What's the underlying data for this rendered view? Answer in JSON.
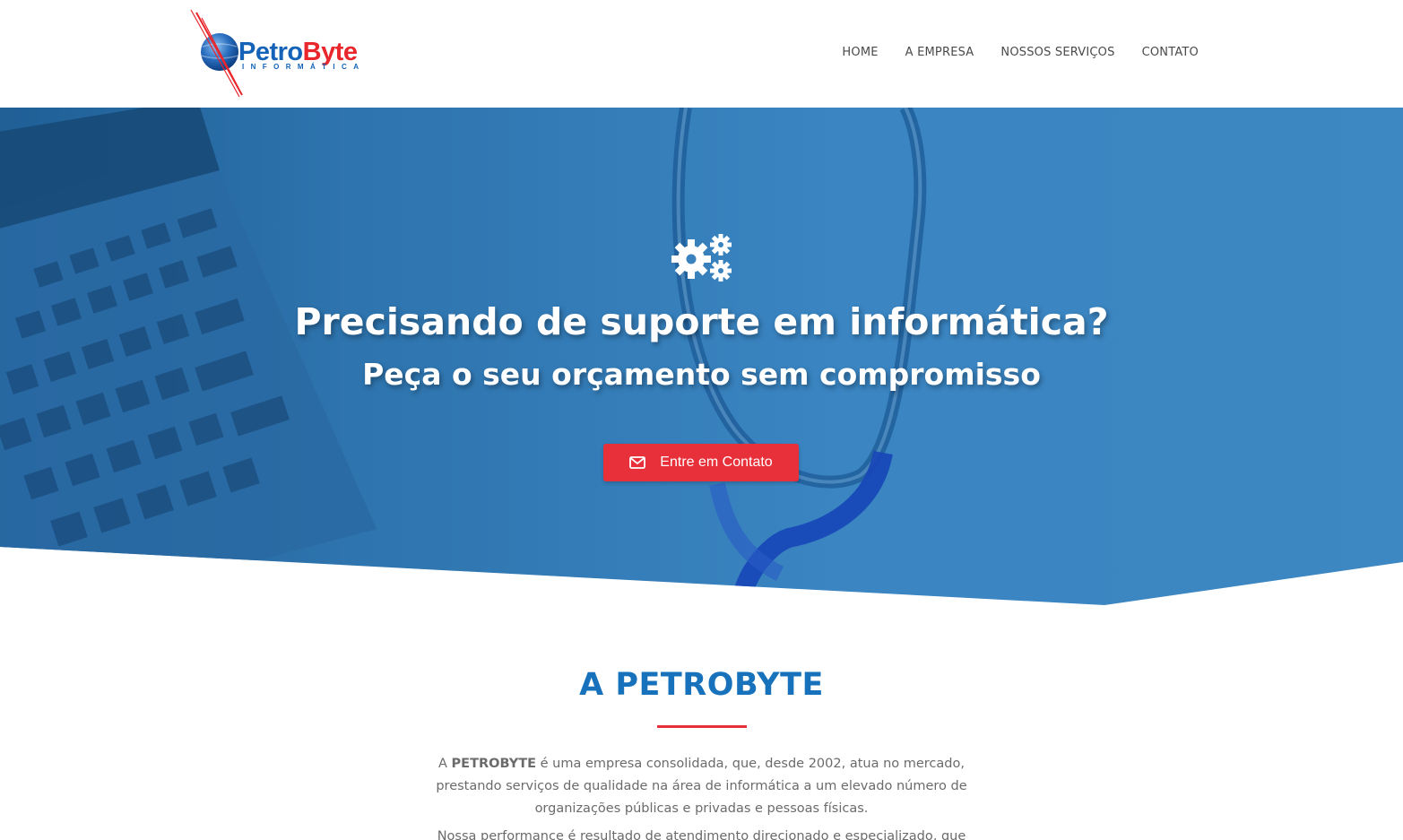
{
  "brand": {
    "name_part1": "Petro",
    "name_part2": "Byte",
    "tagline": "INFORMÁTICA"
  },
  "nav": {
    "items": [
      {
        "label": "HOME"
      },
      {
        "label": "A EMPRESA"
      },
      {
        "label": "NOSSOS SERVIÇOS"
      },
      {
        "label": "CONTATO"
      }
    ]
  },
  "hero": {
    "icon": "gears-icon",
    "title": "Precisando de suporte em informática?",
    "subtitle": "Peça o seu orçamento sem compromisso",
    "cta_label": "Entre em Contato",
    "cta_icon": "envelope-icon"
  },
  "about": {
    "title": "A PETROBYTE",
    "p1_prefix": "A ",
    "p1_bold": "PETROBYTE",
    "p1_rest": " é uma empresa consolidada, que, desde 2002, atua no mercado, prestando serviços de qualidade na área de informática a um elevado número de organizações públicas e privadas e pessoas físicas.",
    "p2": "Nossa performance é resultado de atendimento direcionado e especializado, que"
  },
  "colors": {
    "primary_blue": "#1772bb",
    "accent_red": "#e8303a",
    "hero_blue": "#3a82bd"
  }
}
